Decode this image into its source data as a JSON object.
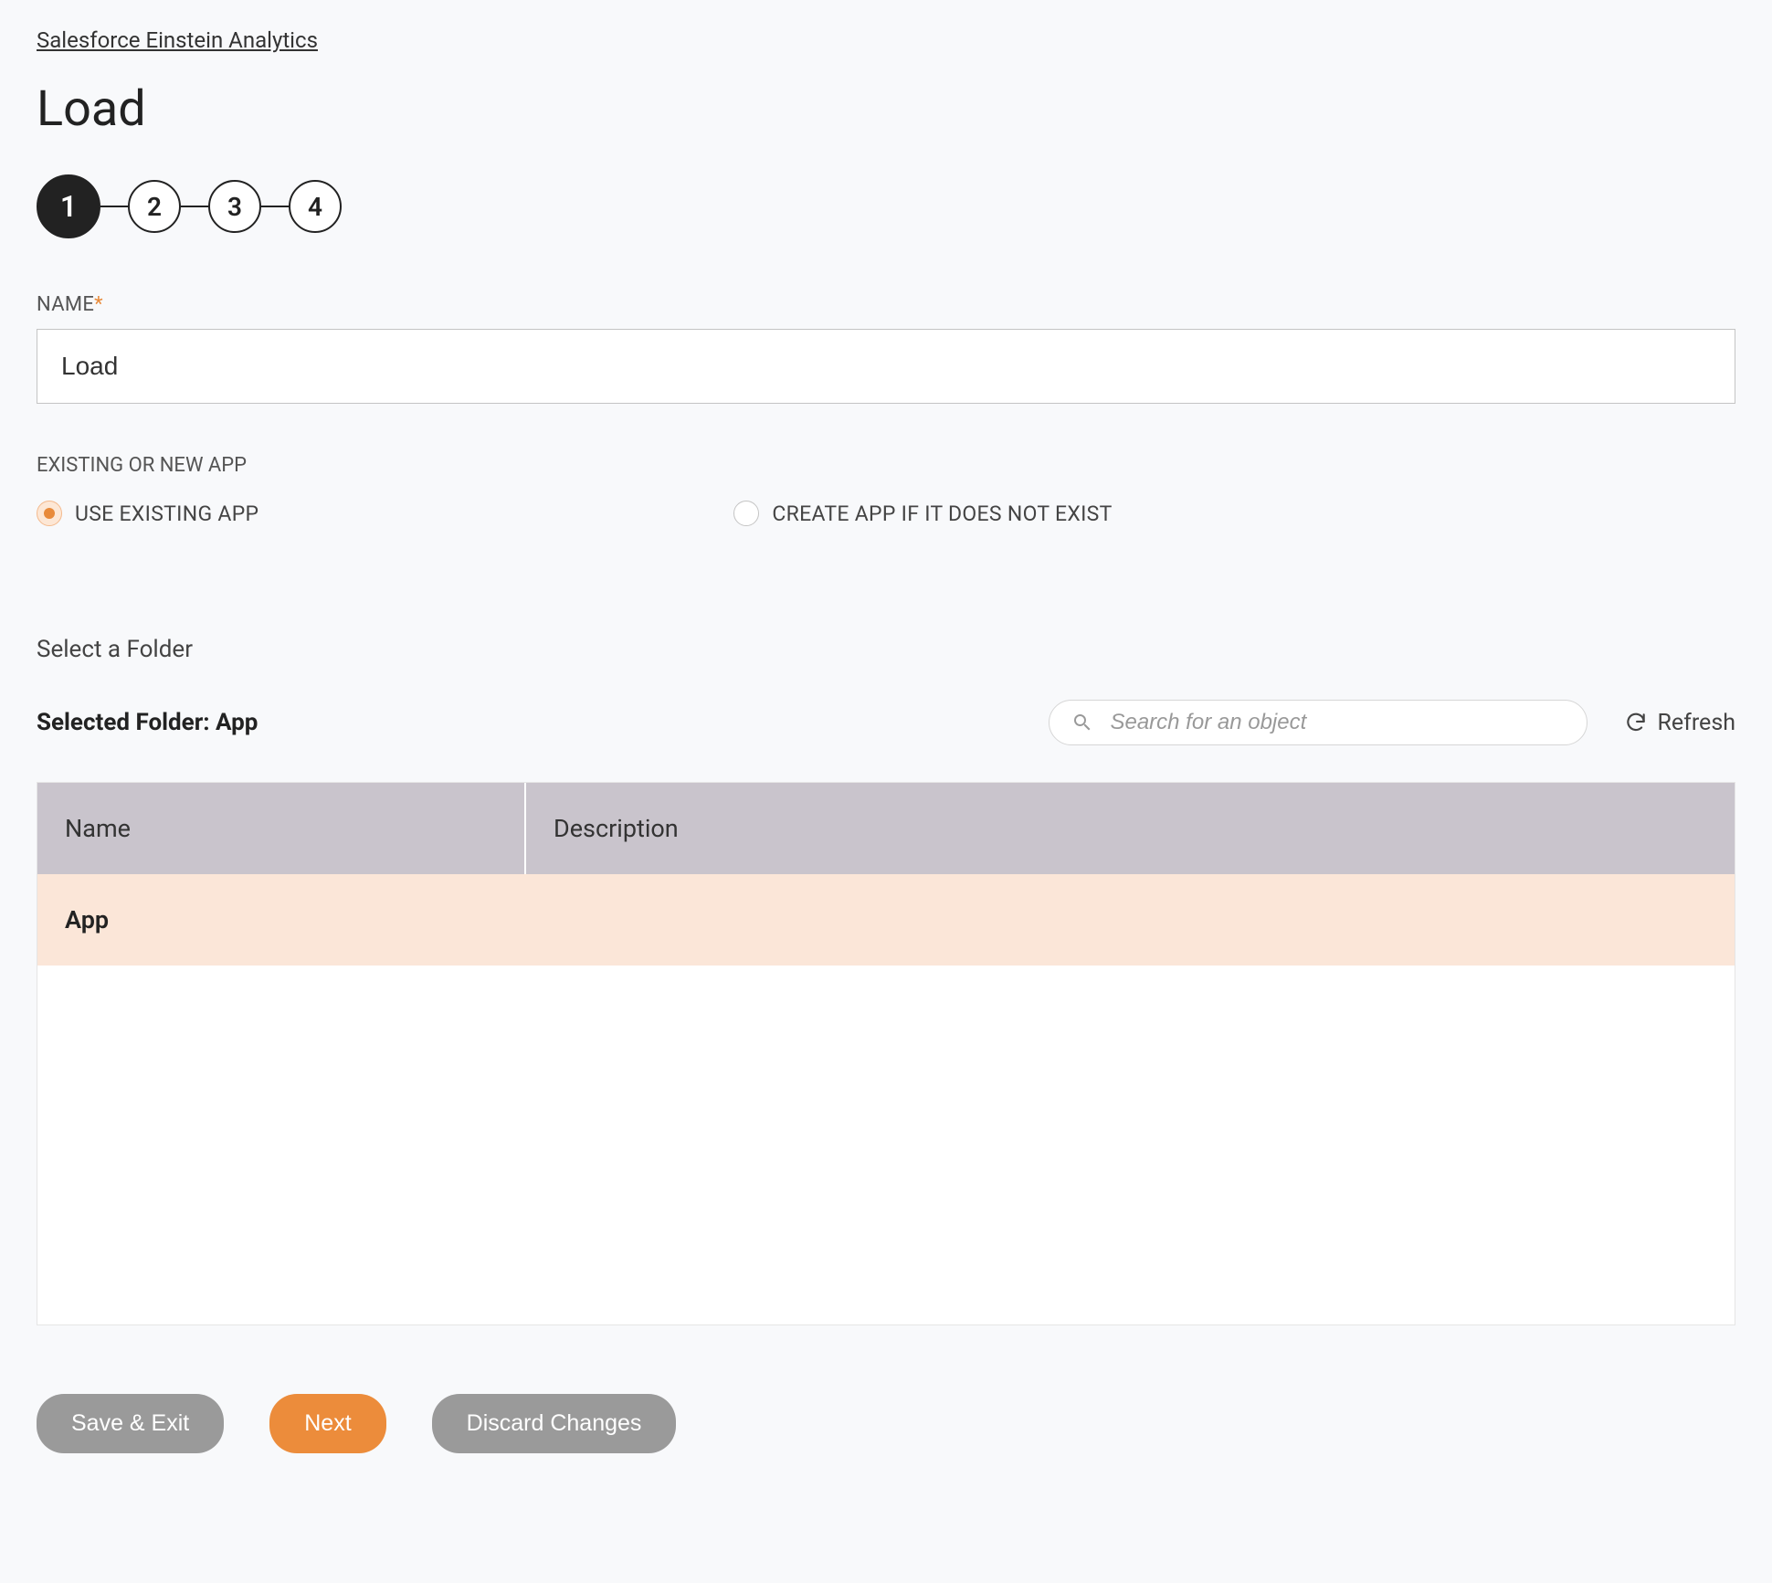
{
  "breadcrumb": "Salesforce Einstein Analytics",
  "page_title": "Load",
  "stepper": {
    "steps": [
      "1",
      "2",
      "3",
      "4"
    ],
    "active_index": 0
  },
  "name_field": {
    "label": "NAME",
    "required_marker": "*",
    "value": "Load"
  },
  "app_mode": {
    "label": "EXISTING OR NEW APP",
    "options": [
      {
        "label": "USE EXISTING APP",
        "selected": true
      },
      {
        "label": "CREATE APP IF IT DOES NOT EXIST",
        "selected": false
      }
    ]
  },
  "folder_section": {
    "title": "Select a Folder",
    "selected_prefix": "Selected Folder: ",
    "selected_value": "App",
    "search_placeholder": "Search for an object",
    "refresh_label": "Refresh"
  },
  "table": {
    "columns": {
      "name": "Name",
      "description": "Description"
    },
    "rows": [
      {
        "name": "App",
        "description": "",
        "selected": true
      }
    ]
  },
  "buttons": {
    "save_exit": "Save & Exit",
    "next": "Next",
    "discard": "Discard Changes"
  }
}
